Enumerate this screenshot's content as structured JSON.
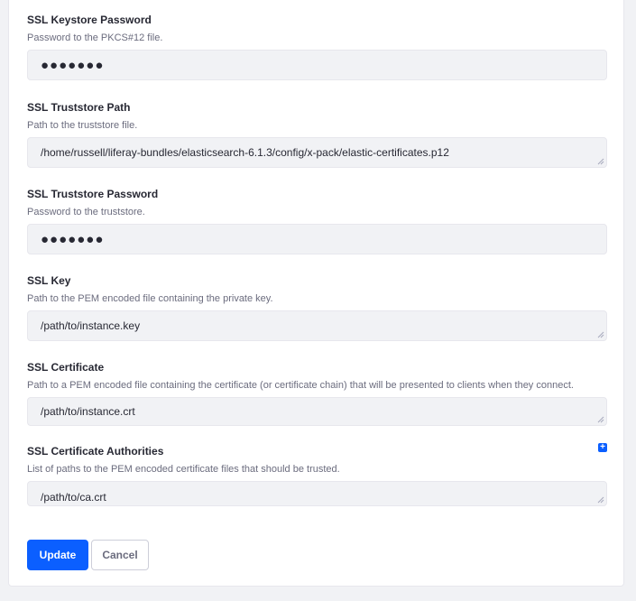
{
  "fields": [
    {
      "label": "SSL Keystore Password",
      "help": "Password to the PKCS#12 file.",
      "value": "●●●●●●●"
    },
    {
      "label": "SSL Truststore Path",
      "help": "Path to the truststore file.",
      "value": "/home/russell/liferay-bundles/elasticsearch-6.1.3/config/x-pack/elastic-certificates.p12"
    },
    {
      "label": "SSL Truststore Password",
      "help": "Password to the truststore.",
      "value": "●●●●●●●"
    },
    {
      "label": "SSL Key",
      "help": "Path to the PEM encoded file containing the private key.",
      "value": "/path/to/instance.key"
    },
    {
      "label": "SSL Certificate",
      "help": "Path to a PEM encoded file containing the certificate (or certificate chain) that will be presented to clients when they connect.",
      "value": "/path/to/instance.crt"
    },
    {
      "label": "SSL Certificate Authorities",
      "help": "List of paths to the PEM encoded certificate files that should be trusted.",
      "value": "/path/to/ca.crt",
      "add_icon": "+"
    }
  ],
  "buttons": {
    "update": "Update",
    "cancel": "Cancel"
  },
  "colors": {
    "primary": "#0b5fff",
    "input_bg": "#f1f2f5"
  }
}
